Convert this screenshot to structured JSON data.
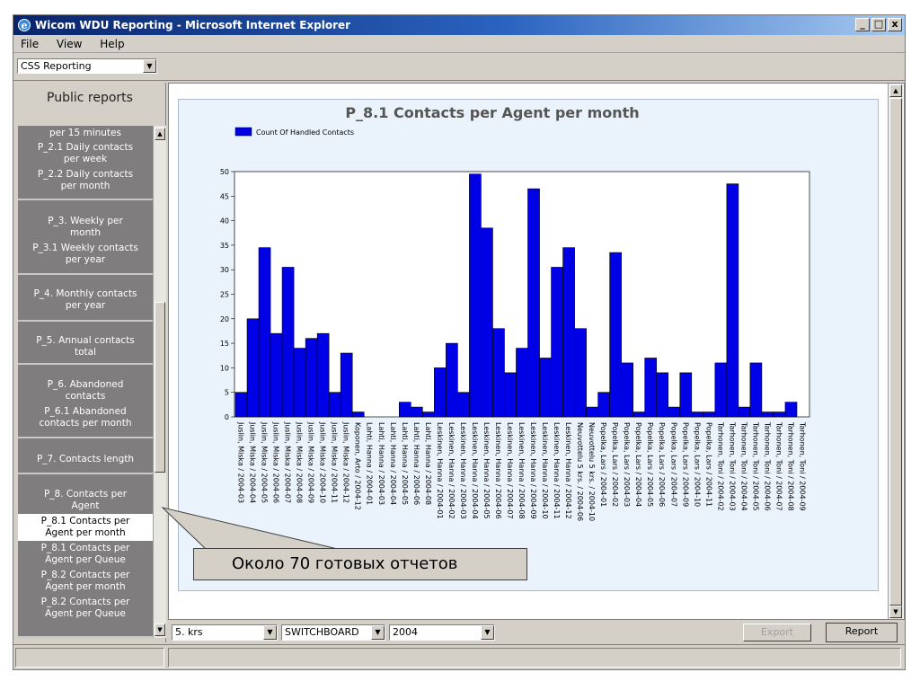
{
  "window": {
    "title": "Wicom WDU Reporting - Microsoft Internet Explorer",
    "controls": [
      "_",
      "□",
      "x"
    ]
  },
  "menu": [
    "File",
    "View",
    "Help"
  ],
  "toolbar": {
    "app_select": "CSS Reporting"
  },
  "sidebar": {
    "header": "Public reports",
    "groups": [
      {
        "items": [
          {
            "label": "per 15 minutes"
          },
          {
            "label": "P_2.1 Daily contacts per week"
          },
          {
            "label": "P_2.2 Daily contacts per month"
          }
        ]
      },
      {
        "items": [
          {
            "label": "P_3. Weekly per month"
          },
          {
            "label": "P_3.1 Weekly contacts per year"
          }
        ]
      },
      {
        "items": [
          {
            "label": "P_4. Monthly contacts per year"
          }
        ]
      },
      {
        "items": [
          {
            "label": "P_5. Annual contacts total"
          }
        ]
      },
      {
        "items": [
          {
            "label": "P_6. Abandoned contacts"
          },
          {
            "label": "P_6.1 Abandoned contacts per month"
          }
        ]
      },
      {
        "items": [
          {
            "label": "P_7. Contacts length"
          }
        ]
      },
      {
        "items": [
          {
            "label": "P_8. Contacts per Agent"
          },
          {
            "label": "P_8.1 Contacts per Agent per month",
            "selected": true
          },
          {
            "label": "P_8.1 Contacts per Agent per Queue"
          },
          {
            "label": "P_8.2 Contacts per Agent per month"
          },
          {
            "label": "P_8.2 Contacts per Agent per Queue"
          }
        ]
      }
    ]
  },
  "bottom": {
    "filter1": "5. krs",
    "filter2": "SWITCHBOARD",
    "filter3": "2004",
    "export_label": "Export",
    "report_label": "Report"
  },
  "callout": {
    "text": "Около 70 готовых отчетов"
  },
  "colors": {
    "bar": "#0000e6",
    "chart_bg": "#eaf2fb",
    "sidebar": "#807d7e"
  },
  "chart_data": {
    "type": "bar",
    "title": "P_8.1 Contacts per Agent per month",
    "legend": "Count Of Handled Contacts",
    "legend_position": "top-left",
    "ylim": [
      0,
      50
    ],
    "yticks": [
      0,
      5,
      10,
      15,
      20,
      25,
      30,
      35,
      40,
      45,
      50
    ],
    "categories": [
      "Juslin, Miska / 2004-03",
      "Juslin, Miska / 2004-04",
      "Juslin, Miska / 2004-05",
      "Juslin, Miska / 2004-06",
      "Juslin, Miska / 2004-07",
      "Juslin, Miska / 2004-08",
      "Juslin, Miska / 2004-09",
      "Juslin, Miska / 2004-10",
      "Juslin, Miska / 2004-11",
      "Juslin, Miska / 2004-12",
      "Koponen, Arto / 2004-12",
      "Lahti, Hanna / 2004-01",
      "Lahti, Hanna / 2004-03",
      "Lahti, Hanna / 2004-04",
      "Lahti, Hanna / 2004-05",
      "Lahti, Hanna / 2004-06",
      "Lahti, Hanna / 2004-08",
      "Leskinen, Hanna / 2004-01",
      "Leskinen, Hanna / 2004-02",
      "Leskinen, Hanna / 2004-03",
      "Leskinen, Hanna / 2004-04",
      "Leskinen, Hanna / 2004-05",
      "Leskinen, Hanna / 2004-06",
      "Leskinen, Hanna / 2004-07",
      "Leskinen, Hanna / 2004-08",
      "Leskinen, Hanna / 2004-09",
      "Leskinen, Hanna / 2004-10",
      "Leskinen, Hanna / 2004-11",
      "Leskinen, Hanna / 2004-12",
      "Neuvottelu 5 krs. / 2004-06",
      "Neuvottelu 5 krs. / 2004-10",
      "Popelka, Lars / 2004-01",
      "Popelka, Lars / 2004-02",
      "Popelka, Lars / 2004-03",
      "Popelka, Lars / 2004-04",
      "Popelka, Lars / 2004-05",
      "Popelka, Lars / 2004-06",
      "Popelka, Lars / 2004-07",
      "Popelka, Lars / 2004-09",
      "Popelka, Lars / 2004-10",
      "Popelka, Lars / 2004-11",
      "Tarhonen, Toni / 2004-02",
      "Tarhonen, Toni / 2004-03",
      "Tarhonen, Toni / 2004-04",
      "Tarhonen, Toni / 2004-05",
      "Tarhonen, Toni / 2004-06",
      "Tarhonen, Toni / 2004-07",
      "Tarhonen, Toni / 2004-08",
      "Tarhonen, Toni / 2004-09"
    ],
    "values": [
      5,
      20,
      34.5,
      17,
      30.5,
      14,
      16,
      17,
      5,
      13,
      1,
      0,
      0,
      0,
      3,
      2,
      1,
      10,
      15,
      5,
      49.5,
      38.5,
      18,
      9,
      14,
      46.5,
      12,
      30.5,
      34.5,
      18,
      2,
      5,
      33.5,
      11,
      1,
      12,
      9,
      2,
      9,
      1,
      1,
      11,
      47.5,
      2,
      11,
      1,
      1,
      3,
      0
    ]
  }
}
